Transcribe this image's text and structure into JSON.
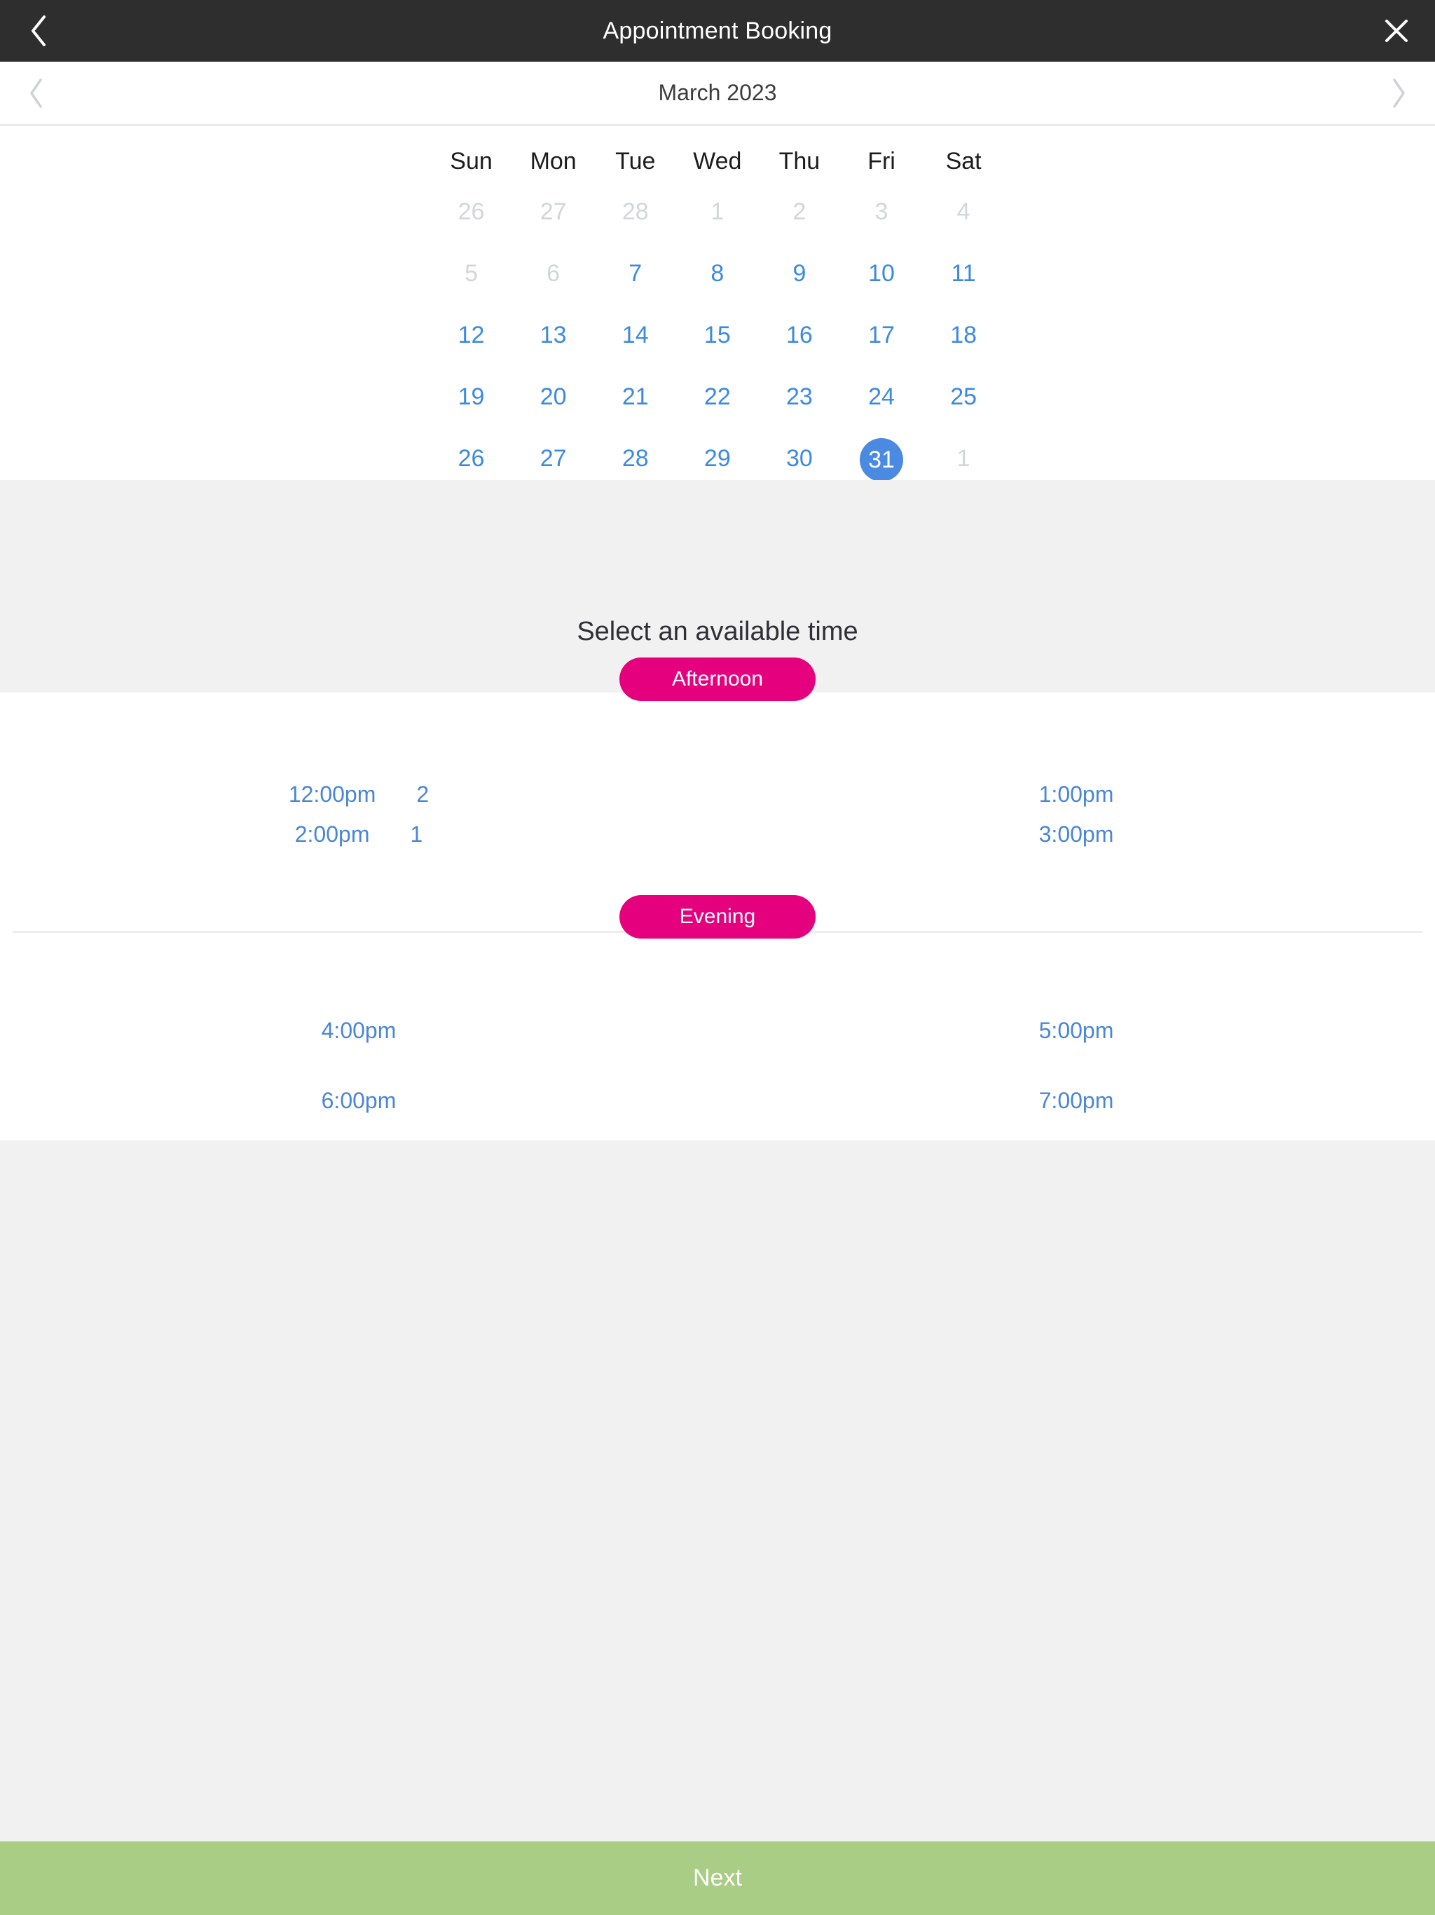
{
  "appbar": {
    "title": "Appointment Booking",
    "back_icon": "chevron-left-icon",
    "close_icon": "close-x-icon"
  },
  "month_nav": {
    "label": "March 2023",
    "prev_icon": "chevron-left-icon",
    "next_icon": "chevron-right-icon"
  },
  "calendar": {
    "weekday_headers": [
      "Sun",
      "Mon",
      "Tue",
      "Wed",
      "Thu",
      "Fri",
      "Sat"
    ],
    "selected_day": "31",
    "weeks": [
      [
        {
          "day": "26",
          "state": "muted"
        },
        {
          "day": "27",
          "state": "muted"
        },
        {
          "day": "28",
          "state": "muted"
        },
        {
          "day": "1",
          "state": "muted"
        },
        {
          "day": "2",
          "state": "muted"
        },
        {
          "day": "3",
          "state": "muted"
        },
        {
          "day": "4",
          "state": "muted"
        }
      ],
      [
        {
          "day": "5",
          "state": "muted"
        },
        {
          "day": "6",
          "state": "muted"
        },
        {
          "day": "7",
          "state": "available"
        },
        {
          "day": "8",
          "state": "available"
        },
        {
          "day": "9",
          "state": "available"
        },
        {
          "day": "10",
          "state": "available"
        },
        {
          "day": "11",
          "state": "available"
        }
      ],
      [
        {
          "day": "12",
          "state": "available"
        },
        {
          "day": "13",
          "state": "available"
        },
        {
          "day": "14",
          "state": "available"
        },
        {
          "day": "15",
          "state": "available"
        },
        {
          "day": "16",
          "state": "available"
        },
        {
          "day": "17",
          "state": "available"
        },
        {
          "day": "18",
          "state": "available"
        }
      ],
      [
        {
          "day": "19",
          "state": "available"
        },
        {
          "day": "20",
          "state": "available"
        },
        {
          "day": "21",
          "state": "available"
        },
        {
          "day": "22",
          "state": "available"
        },
        {
          "day": "23",
          "state": "available"
        },
        {
          "day": "24",
          "state": "available"
        },
        {
          "day": "25",
          "state": "available"
        }
      ],
      [
        {
          "day": "26",
          "state": "available"
        },
        {
          "day": "27",
          "state": "available"
        },
        {
          "day": "28",
          "state": "available"
        },
        {
          "day": "29",
          "state": "available"
        },
        {
          "day": "30",
          "state": "available"
        },
        {
          "day": "31",
          "state": "selected"
        },
        {
          "day": "1",
          "state": "muted"
        }
      ]
    ]
  },
  "time_section": {
    "heading": "Select an available time",
    "groups": [
      {
        "label": "Afternoon",
        "rows": [
          {
            "left_time": "12:00pm",
            "left_count": "2",
            "right_time": "1:00pm",
            "right_count": ""
          },
          {
            "left_time": "2:00pm",
            "left_count": "1",
            "right_time": "3:00pm",
            "right_count": ""
          }
        ]
      },
      {
        "label": "Evening",
        "rows": [
          {
            "left_time": "4:00pm",
            "left_count": "",
            "right_time": "5:00pm",
            "right_count": ""
          },
          {
            "left_time": "6:00pm",
            "left_count": "",
            "right_time": "7:00pm",
            "right_count": ""
          }
        ]
      }
    ]
  },
  "footer": {
    "next_label": "Next"
  },
  "colors": {
    "appbar_bg": "#2e2e2e",
    "accent_blue": "#4a86d6",
    "selected_blue": "#4a8ae0",
    "pill_magenta": "#e5007e",
    "next_green": "#aacd85",
    "panel_gray": "#f1f1f1"
  }
}
